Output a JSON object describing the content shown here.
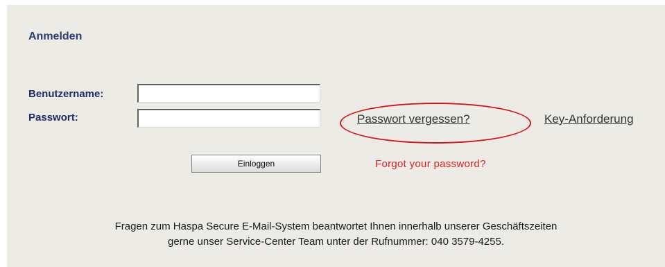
{
  "login": {
    "title": "Anmelden",
    "username_label": "Benutzername:",
    "username_value": "",
    "password_label": "Passwort:",
    "password_value": "",
    "forgot_link": "Passwort vergessen?",
    "key_link": "Key-Anforderung",
    "submit_label": "Einloggen",
    "forgot_note": "Forgot your password?",
    "highlight_color": "#d8141c"
  },
  "footer": {
    "line1": "Fragen zum Haspa Secure E-Mail-System beantwortet Ihnen innerhalb unserer Geschäftszeiten",
    "line2": "gerne unser Service-Center Team unter der Rufnummer: 040 3579-4255."
  }
}
